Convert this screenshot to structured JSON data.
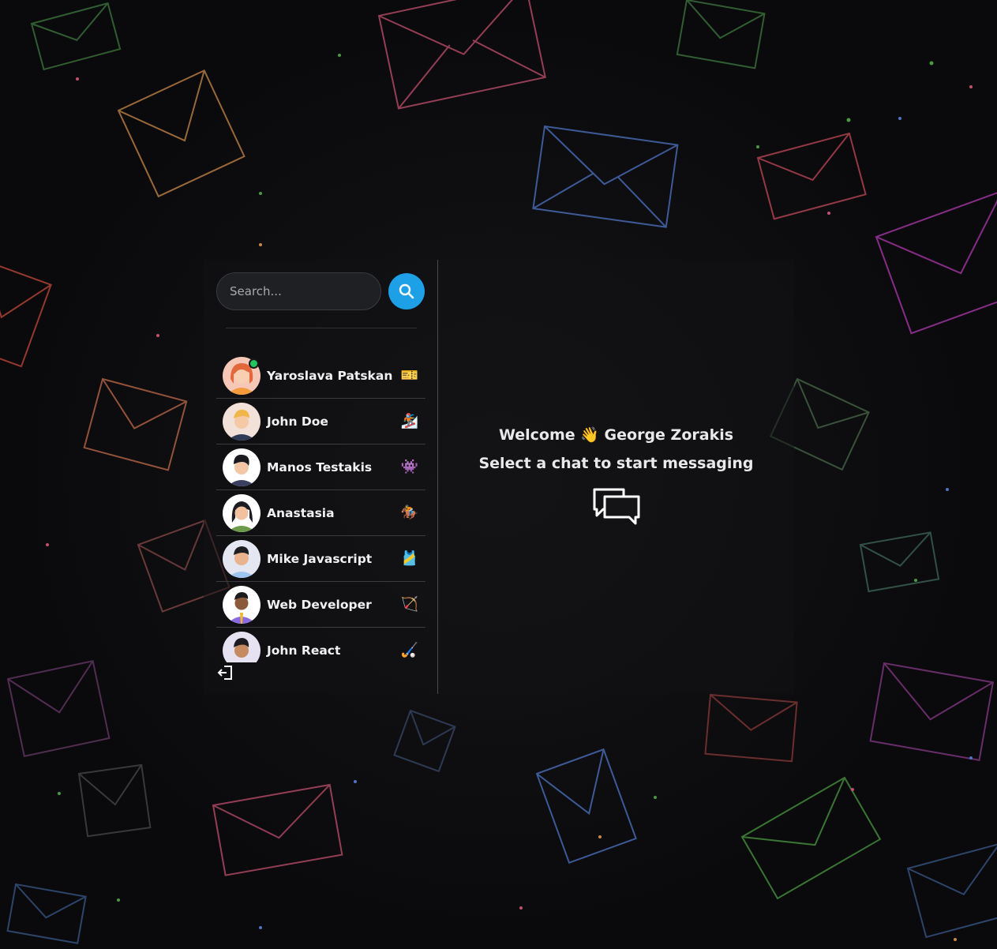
{
  "search": {
    "placeholder": "Search..."
  },
  "conversations": [
    {
      "name": "Yaroslava Patskan",
      "emoji": "🎫",
      "online": true,
      "avatar_icon": "woman-orange-avatar"
    },
    {
      "name": "John Doe",
      "emoji": "🏂",
      "online": false,
      "avatar_icon": "man-blonde-avatar"
    },
    {
      "name": "Manos Testakis",
      "emoji": "👾",
      "online": false,
      "avatar_icon": "man-dark-hair-avatar"
    },
    {
      "name": "Anastasia",
      "emoji": "🏇",
      "online": false,
      "avatar_icon": "woman-green-avatar"
    },
    {
      "name": "Mike Javascript",
      "emoji": "🎽",
      "online": false,
      "avatar_icon": "man-blue-shirt-avatar"
    },
    {
      "name": "Web Developer",
      "emoji": "🏹",
      "online": false,
      "avatar_icon": "man-yellow-tie-avatar"
    },
    {
      "name": "John React",
      "emoji": "🏑",
      "online": false,
      "avatar_icon": "man-purple-avatar"
    }
  ],
  "welcome": {
    "line1": "Welcome 👋 George Zorakis",
    "line2": "Select a chat to start messaging"
  },
  "colors": {
    "accent": "#1ea0e6",
    "online": "#22c55e"
  }
}
